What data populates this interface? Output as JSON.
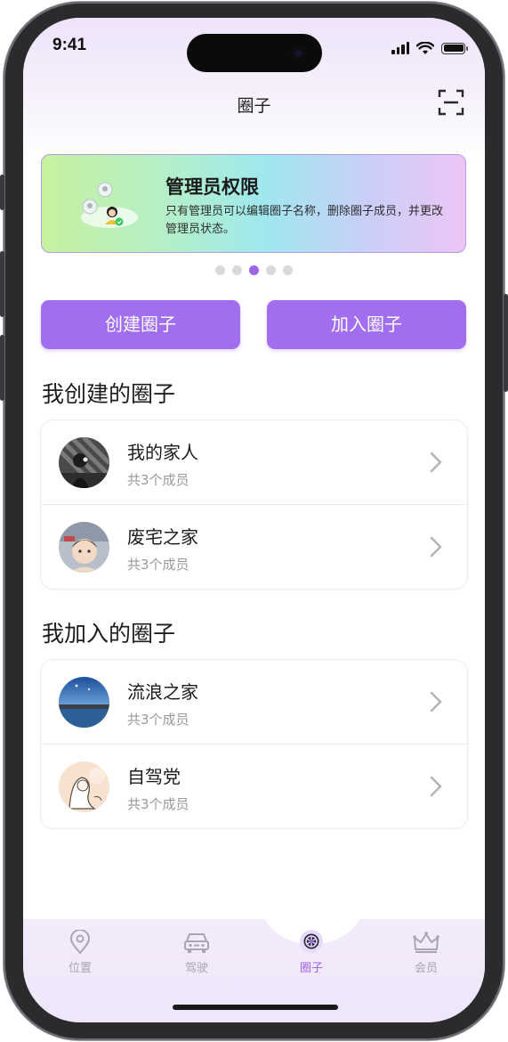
{
  "status": {
    "time": "9:41"
  },
  "nav": {
    "title": "圈子",
    "scan_icon": "scan-icon"
  },
  "banner": {
    "title": "管理员权限",
    "description": "只有管理员可以编辑圈子名称，删除圈子成员，并更改管理员状态。",
    "page_count": 5,
    "active_page": 3
  },
  "actions": {
    "create_label": "创建圈子",
    "join_label": "加入圈子"
  },
  "created_section": {
    "title": "我创建的圈子",
    "items": [
      {
        "name": "我的家人",
        "members": "共3个成员"
      },
      {
        "name": "废宅之家",
        "members": "共3个成员"
      }
    ]
  },
  "joined_section": {
    "title": "我加入的圈子",
    "items": [
      {
        "name": "流浪之家",
        "members": "共3个成员"
      },
      {
        "name": "自驾党",
        "members": "共3个成员"
      }
    ]
  },
  "tabs": [
    {
      "label": "位置",
      "icon": "location-pin-icon",
      "active": false
    },
    {
      "label": "驾驶",
      "icon": "car-icon",
      "active": false
    },
    {
      "label": "圈子",
      "icon": "circle-wheel-icon",
      "active": true
    },
    {
      "label": "会员",
      "icon": "crown-icon",
      "active": false
    }
  ],
  "colors": {
    "accent": "#A26EF0",
    "active_dot": "#9E65EA",
    "inactive_tab": "#A9A6B0"
  }
}
